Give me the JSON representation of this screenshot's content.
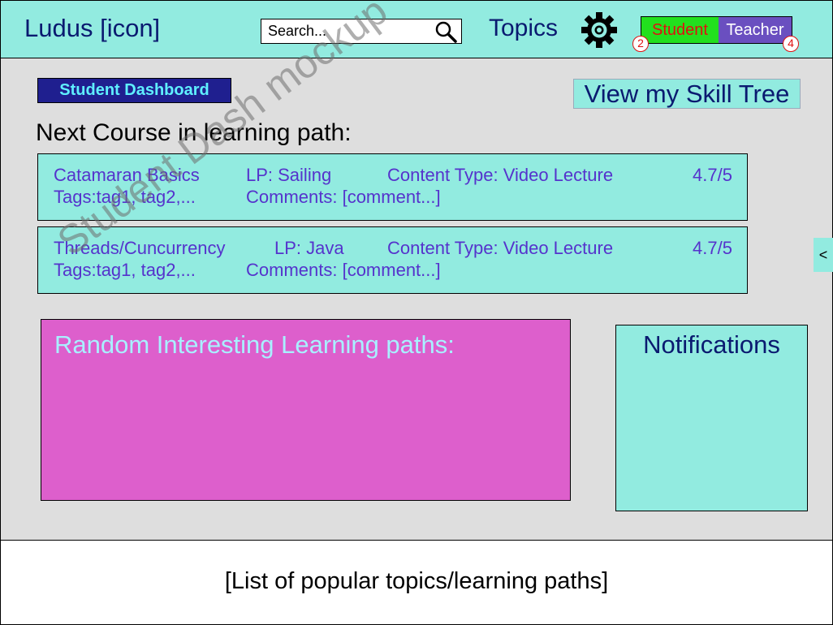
{
  "header": {
    "logo": "Ludus [icon]",
    "search_placeholder": "Search...",
    "topics_label": "Topics",
    "role_student": "Student",
    "role_teacher": "Teacher",
    "student_badge": "2",
    "teacher_badge": "4"
  },
  "dashboard": {
    "label": "Student Dashboard",
    "skill_tree_button": "View my Skill Tree",
    "next_course_heading": "Next Course in learning path:"
  },
  "courses": [
    {
      "name": "Catamaran Basics",
      "lp": "LP: Sailing",
      "content_type": "Content Type: Video Lecture",
      "rating": "4.7/5",
      "tags": "Tags:tag1, tag2,...",
      "comments": "Comments: [comment...]"
    },
    {
      "name": "Threads/Cuncurrency",
      "lp": "LP: Java",
      "content_type": "Content Type: Video Lecture",
      "rating": "4.7/5",
      "tags": "Tags:tag1, tag2,...",
      "comments": "Comments: [comment...]"
    }
  ],
  "side_toggle": "<",
  "random_paths_title": "Random Interesting Learning paths:",
  "notifications_title": "Notifications",
  "footer_text": "[List of popular topics/learning paths]",
  "watermark": "Student Dash mockup",
  "colors": {
    "header_bg": "#92ebe0",
    "main_bg": "#dedede",
    "card_bg": "#92ebe0",
    "card_text": "#5533cc",
    "random_panel_bg": "#dd5fcc",
    "student_toggle_bg": "#22e01e",
    "teacher_toggle_bg": "#6a4fc0",
    "badge_red": "#e01010",
    "dash_label_bg": "#1f1f8f"
  }
}
